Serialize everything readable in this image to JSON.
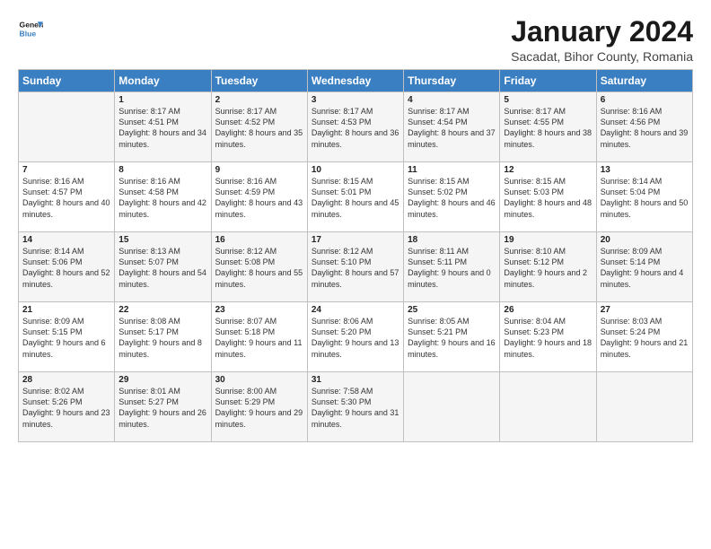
{
  "logo": {
    "line1": "General",
    "line2": "Blue"
  },
  "title": "January 2024",
  "subtitle": "Sacadat, Bihor County, Romania",
  "days_header": [
    "Sunday",
    "Monday",
    "Tuesday",
    "Wednesday",
    "Thursday",
    "Friday",
    "Saturday"
  ],
  "weeks": [
    [
      {
        "num": "",
        "sunrise": "",
        "sunset": "",
        "daylight": ""
      },
      {
        "num": "1",
        "sunrise": "Sunrise: 8:17 AM",
        "sunset": "Sunset: 4:51 PM",
        "daylight": "Daylight: 8 hours and 34 minutes."
      },
      {
        "num": "2",
        "sunrise": "Sunrise: 8:17 AM",
        "sunset": "Sunset: 4:52 PM",
        "daylight": "Daylight: 8 hours and 35 minutes."
      },
      {
        "num": "3",
        "sunrise": "Sunrise: 8:17 AM",
        "sunset": "Sunset: 4:53 PM",
        "daylight": "Daylight: 8 hours and 36 minutes."
      },
      {
        "num": "4",
        "sunrise": "Sunrise: 8:17 AM",
        "sunset": "Sunset: 4:54 PM",
        "daylight": "Daylight: 8 hours and 37 minutes."
      },
      {
        "num": "5",
        "sunrise": "Sunrise: 8:17 AM",
        "sunset": "Sunset: 4:55 PM",
        "daylight": "Daylight: 8 hours and 38 minutes."
      },
      {
        "num": "6",
        "sunrise": "Sunrise: 8:16 AM",
        "sunset": "Sunset: 4:56 PM",
        "daylight": "Daylight: 8 hours and 39 minutes."
      }
    ],
    [
      {
        "num": "7",
        "sunrise": "Sunrise: 8:16 AM",
        "sunset": "Sunset: 4:57 PM",
        "daylight": "Daylight: 8 hours and 40 minutes."
      },
      {
        "num": "8",
        "sunrise": "Sunrise: 8:16 AM",
        "sunset": "Sunset: 4:58 PM",
        "daylight": "Daylight: 8 hours and 42 minutes."
      },
      {
        "num": "9",
        "sunrise": "Sunrise: 8:16 AM",
        "sunset": "Sunset: 4:59 PM",
        "daylight": "Daylight: 8 hours and 43 minutes."
      },
      {
        "num": "10",
        "sunrise": "Sunrise: 8:15 AM",
        "sunset": "Sunset: 5:01 PM",
        "daylight": "Daylight: 8 hours and 45 minutes."
      },
      {
        "num": "11",
        "sunrise": "Sunrise: 8:15 AM",
        "sunset": "Sunset: 5:02 PM",
        "daylight": "Daylight: 8 hours and 46 minutes."
      },
      {
        "num": "12",
        "sunrise": "Sunrise: 8:15 AM",
        "sunset": "Sunset: 5:03 PM",
        "daylight": "Daylight: 8 hours and 48 minutes."
      },
      {
        "num": "13",
        "sunrise": "Sunrise: 8:14 AM",
        "sunset": "Sunset: 5:04 PM",
        "daylight": "Daylight: 8 hours and 50 minutes."
      }
    ],
    [
      {
        "num": "14",
        "sunrise": "Sunrise: 8:14 AM",
        "sunset": "Sunset: 5:06 PM",
        "daylight": "Daylight: 8 hours and 52 minutes."
      },
      {
        "num": "15",
        "sunrise": "Sunrise: 8:13 AM",
        "sunset": "Sunset: 5:07 PM",
        "daylight": "Daylight: 8 hours and 54 minutes."
      },
      {
        "num": "16",
        "sunrise": "Sunrise: 8:12 AM",
        "sunset": "Sunset: 5:08 PM",
        "daylight": "Daylight: 8 hours and 55 minutes."
      },
      {
        "num": "17",
        "sunrise": "Sunrise: 8:12 AM",
        "sunset": "Sunset: 5:10 PM",
        "daylight": "Daylight: 8 hours and 57 minutes."
      },
      {
        "num": "18",
        "sunrise": "Sunrise: 8:11 AM",
        "sunset": "Sunset: 5:11 PM",
        "daylight": "Daylight: 9 hours and 0 minutes."
      },
      {
        "num": "19",
        "sunrise": "Sunrise: 8:10 AM",
        "sunset": "Sunset: 5:12 PM",
        "daylight": "Daylight: 9 hours and 2 minutes."
      },
      {
        "num": "20",
        "sunrise": "Sunrise: 8:09 AM",
        "sunset": "Sunset: 5:14 PM",
        "daylight": "Daylight: 9 hours and 4 minutes."
      }
    ],
    [
      {
        "num": "21",
        "sunrise": "Sunrise: 8:09 AM",
        "sunset": "Sunset: 5:15 PM",
        "daylight": "Daylight: 9 hours and 6 minutes."
      },
      {
        "num": "22",
        "sunrise": "Sunrise: 8:08 AM",
        "sunset": "Sunset: 5:17 PM",
        "daylight": "Daylight: 9 hours and 8 minutes."
      },
      {
        "num": "23",
        "sunrise": "Sunrise: 8:07 AM",
        "sunset": "Sunset: 5:18 PM",
        "daylight": "Daylight: 9 hours and 11 minutes."
      },
      {
        "num": "24",
        "sunrise": "Sunrise: 8:06 AM",
        "sunset": "Sunset: 5:20 PM",
        "daylight": "Daylight: 9 hours and 13 minutes."
      },
      {
        "num": "25",
        "sunrise": "Sunrise: 8:05 AM",
        "sunset": "Sunset: 5:21 PM",
        "daylight": "Daylight: 9 hours and 16 minutes."
      },
      {
        "num": "26",
        "sunrise": "Sunrise: 8:04 AM",
        "sunset": "Sunset: 5:23 PM",
        "daylight": "Daylight: 9 hours and 18 minutes."
      },
      {
        "num": "27",
        "sunrise": "Sunrise: 8:03 AM",
        "sunset": "Sunset: 5:24 PM",
        "daylight": "Daylight: 9 hours and 21 minutes."
      }
    ],
    [
      {
        "num": "28",
        "sunrise": "Sunrise: 8:02 AM",
        "sunset": "Sunset: 5:26 PM",
        "daylight": "Daylight: 9 hours and 23 minutes."
      },
      {
        "num": "29",
        "sunrise": "Sunrise: 8:01 AM",
        "sunset": "Sunset: 5:27 PM",
        "daylight": "Daylight: 9 hours and 26 minutes."
      },
      {
        "num": "30",
        "sunrise": "Sunrise: 8:00 AM",
        "sunset": "Sunset: 5:29 PM",
        "daylight": "Daylight: 9 hours and 29 minutes."
      },
      {
        "num": "31",
        "sunrise": "Sunrise: 7:58 AM",
        "sunset": "Sunset: 5:30 PM",
        "daylight": "Daylight: 9 hours and 31 minutes."
      },
      {
        "num": "",
        "sunrise": "",
        "sunset": "",
        "daylight": ""
      },
      {
        "num": "",
        "sunrise": "",
        "sunset": "",
        "daylight": ""
      },
      {
        "num": "",
        "sunrise": "",
        "sunset": "",
        "daylight": ""
      }
    ]
  ]
}
